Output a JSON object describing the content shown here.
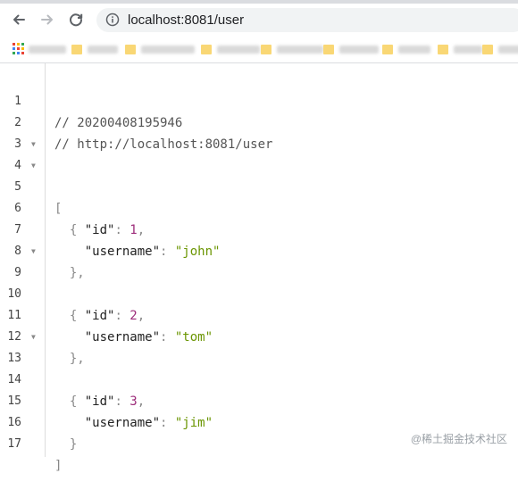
{
  "browser": {
    "url": "localhost:8081/user",
    "colors": {
      "toolbar_bg": "#ffffff",
      "omnibox_bg": "#f1f3f4",
      "folder": "#f9d775"
    }
  },
  "viewer": {
    "lines": [
      {
        "n": "1"
      },
      {
        "n": "2"
      },
      {
        "n": "3"
      },
      {
        "n": "4"
      },
      {
        "n": "5"
      },
      {
        "n": "6"
      },
      {
        "n": "7"
      },
      {
        "n": "8"
      },
      {
        "n": "9"
      },
      {
        "n": "10"
      },
      {
        "n": "11"
      },
      {
        "n": "12"
      },
      {
        "n": "13"
      },
      {
        "n": "14"
      },
      {
        "n": "15"
      },
      {
        "n": "16"
      },
      {
        "n": "17"
      }
    ],
    "comment_timestamp": "// 20200408195946",
    "comment_url": "// http://localhost:8081/user",
    "open_bracket": "[",
    "close_bracket": "]",
    "open_brace": "{",
    "close_brace_comma": "},",
    "close_brace": "}",
    "key_id": "\"id\"",
    "key_username": "\"username\"",
    "colon": ": ",
    "comma": ",",
    "users": [
      {
        "id": "1",
        "username": "\"john\""
      },
      {
        "id": "2",
        "username": "\"tom\""
      },
      {
        "id": "3",
        "username": "\"jim\""
      }
    ],
    "colors": {
      "number": "#9d2c7a",
      "string": "#6a9500",
      "punctuation": "#888888"
    }
  },
  "watermark": "@稀土掘金技术社区"
}
